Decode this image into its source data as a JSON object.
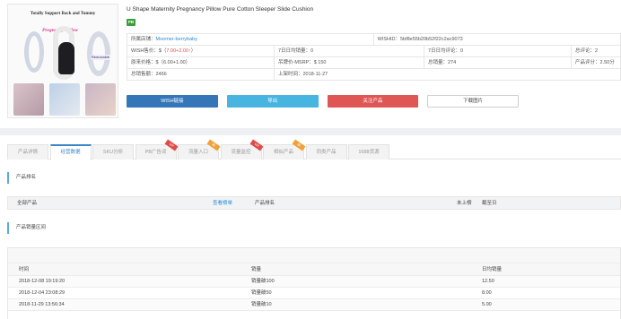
{
  "product": {
    "image_text_top": "Totally Support Back and Tummy",
    "image_text_pink": "Pregnancy Pillow",
    "image_badge": "Removable",
    "title": "U Shape Maternity Pregnancy Pillow Pure Cotton Sleeper Slide Cushion",
    "tag": "PB"
  },
  "info": {
    "store_label": "所属店铺：",
    "store_value": "Moomer-berrybaby",
    "wish_id": "WISHID：5bf8e55b20b52f22c2ac9073",
    "price_label": "WISH售价：$（",
    "price_value": "7.00+2.00",
    "price_arrow": "↑",
    "price_end": "）",
    "sales7": "7日日均销量：0",
    "reviews7": "7日日均评论：0",
    "total_reviews": "总评论：2",
    "original_price": "原来价格：$（6.00+1.00）",
    "msrp": "吊牌价-MSRP：$ 150",
    "total_sales": "总销量：274",
    "rating": "产品评分：2.50分",
    "total_revenue": "总销售额：2466",
    "listed": "上架时间：2018-11-27"
  },
  "buttons": [
    "WISH链接",
    "导出",
    "关注产品",
    "下载图片"
  ],
  "tabs": [
    {
      "label": "产品详情",
      "ribbon": ""
    },
    {
      "label": "经营数据",
      "ribbon": ""
    },
    {
      "label": "SKU分析",
      "ribbon": ""
    },
    {
      "label": "PB广告词",
      "ribbon": "VIP"
    },
    {
      "label": "流量入口",
      "ribbon": "新"
    },
    {
      "label": "流量监控",
      "ribbon": "VIP"
    },
    {
      "label": "相似产品",
      "ribbon": "新"
    },
    {
      "label": "同类产品",
      "ribbon": ""
    },
    {
      "label": "1688货源",
      "ribbon": ""
    }
  ],
  "section1": {
    "title": "产品排名",
    "all_products": "全部产品",
    "view_ranks": "查看榜单",
    "product_rank": "产品排名",
    "not_ranked": "未上榜",
    "as_of": "截至日"
  },
  "section2": {
    "title": "产品销量区间",
    "columns": [
      "时间",
      "销量",
      "日均销量"
    ],
    "rows": [
      {
        "time": "2018-12-08 19:19:20",
        "volume": "销量破100",
        "daily": "12.50"
      },
      {
        "time": "2018-12-04 23:08:29",
        "volume": "销量破50",
        "daily": "8.00"
      },
      {
        "time": "2018-11-29 13:56:34",
        "volume": "销量破10",
        "daily": "5.00"
      }
    ]
  },
  "colors": {
    "primary_blue": "#3576b8",
    "cyan": "#48b5e1",
    "red": "#df5755",
    "tab_active": "#3b86c7",
    "pb_green": "#3c9e3b"
  }
}
